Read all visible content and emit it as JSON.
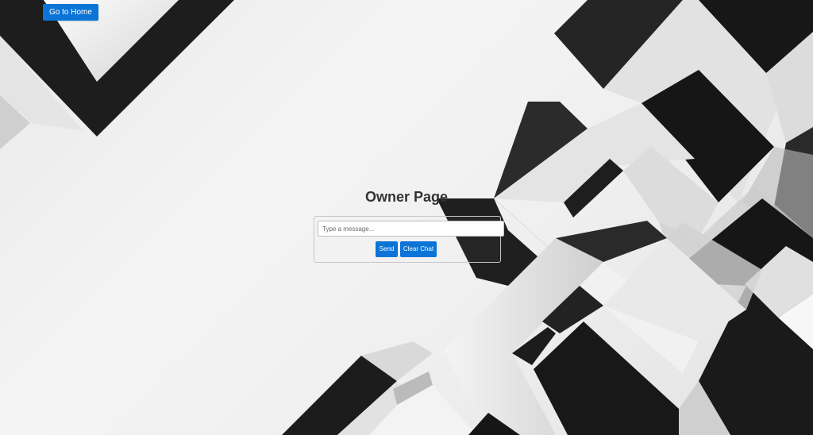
{
  "nav": {
    "home_label": "Go to Home"
  },
  "main": {
    "title": "Owner Page"
  },
  "chat": {
    "input_value": "",
    "input_placeholder": "Type a message...",
    "send_label": "Send",
    "clear_label": "Clear Chat"
  },
  "colors": {
    "accent": "#0b74d6",
    "title_text": "#333333",
    "background": "#f0f0f0",
    "shape_dark": "#1c1c1c",
    "shape_light": "#e6e6e6"
  }
}
